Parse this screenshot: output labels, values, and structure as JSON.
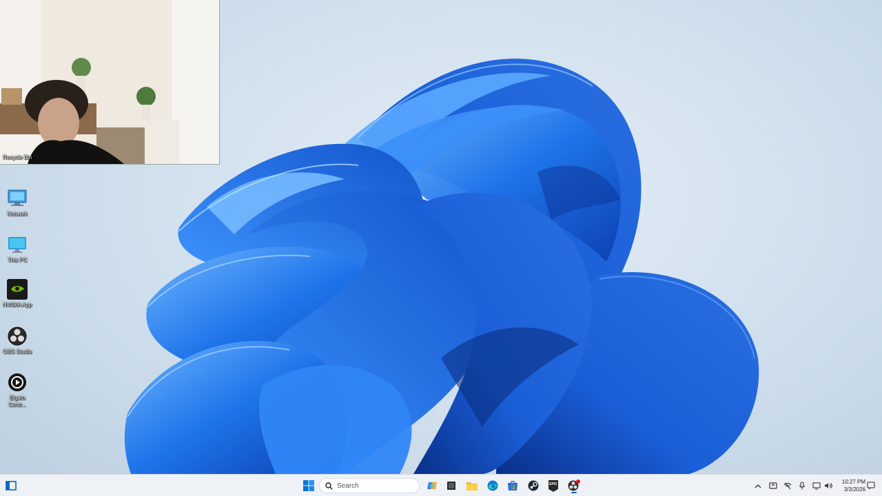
{
  "desktop": {
    "icons": [
      {
        "label": "Recycle Bin",
        "icon": "recycle-bin-icon"
      },
      {
        "label": "Network",
        "icon": "network-icon"
      },
      {
        "label": "This PC",
        "icon": "this-pc-icon"
      },
      {
        "label": "NVIDIA App",
        "icon": "nvidia-app-icon"
      },
      {
        "label": "OBS Studio",
        "icon": "obs-studio-icon"
      },
      {
        "label": "Elgato Contr...",
        "icon": "elgato-icon"
      }
    ]
  },
  "taskbar": {
    "search_placeholder": "Search",
    "apps": [
      "start-icon",
      "copilot-icon",
      "task-view-icon",
      "file-explorer-icon",
      "edge-icon",
      "store-icon",
      "steam-icon",
      "epic-games-icon",
      "obs-studio-icon"
    ],
    "epic_label": "EPIC",
    "clock": {
      "time": "10:27 PM",
      "date": "3/3/2026"
    }
  },
  "colors": {
    "taskbar_bg": "#eef1f5",
    "accent": "#0067c0",
    "bloom": "#1a6fe8"
  }
}
